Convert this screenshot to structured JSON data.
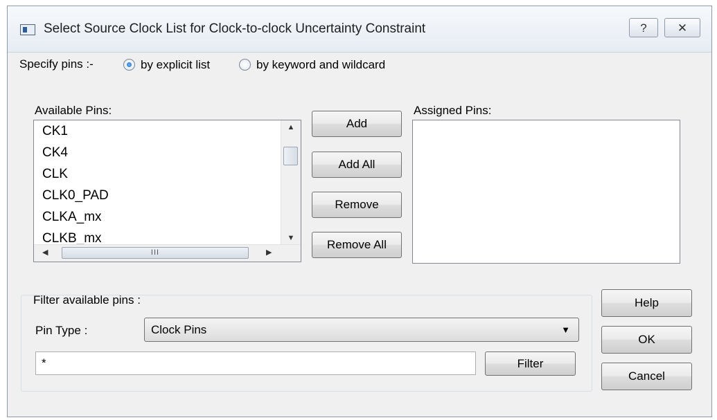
{
  "window": {
    "title": "Select Source Clock List for Clock-to-clock Uncertainty Constraint",
    "help_glyph": "?",
    "close_glyph": "✕"
  },
  "specify": {
    "label": "Specify pins :-",
    "option_explicit": "by explicit list",
    "option_keyword": "by keyword and wildcard",
    "selected": "by explicit list"
  },
  "available": {
    "label": "Available Pins:",
    "items": [
      "CK1",
      "CK4",
      "CLK",
      "CLK0_PAD",
      "CLKA_mx",
      "CLKB_mx"
    ],
    "hscroll_grip": "III"
  },
  "assigned": {
    "label": "Assigned Pins:",
    "items": []
  },
  "transfer_buttons": {
    "add": "Add",
    "add_all": "Add All",
    "remove": "Remove",
    "remove_all": "Remove All"
  },
  "filter": {
    "group_label": "Filter available pins :",
    "pin_type_label": "Pin Type :",
    "pin_type_value": "Clock Pins",
    "pattern_value": "*",
    "filter_button": "Filter"
  },
  "dialog_buttons": {
    "help": "Help",
    "ok": "OK",
    "cancel": "Cancel"
  }
}
